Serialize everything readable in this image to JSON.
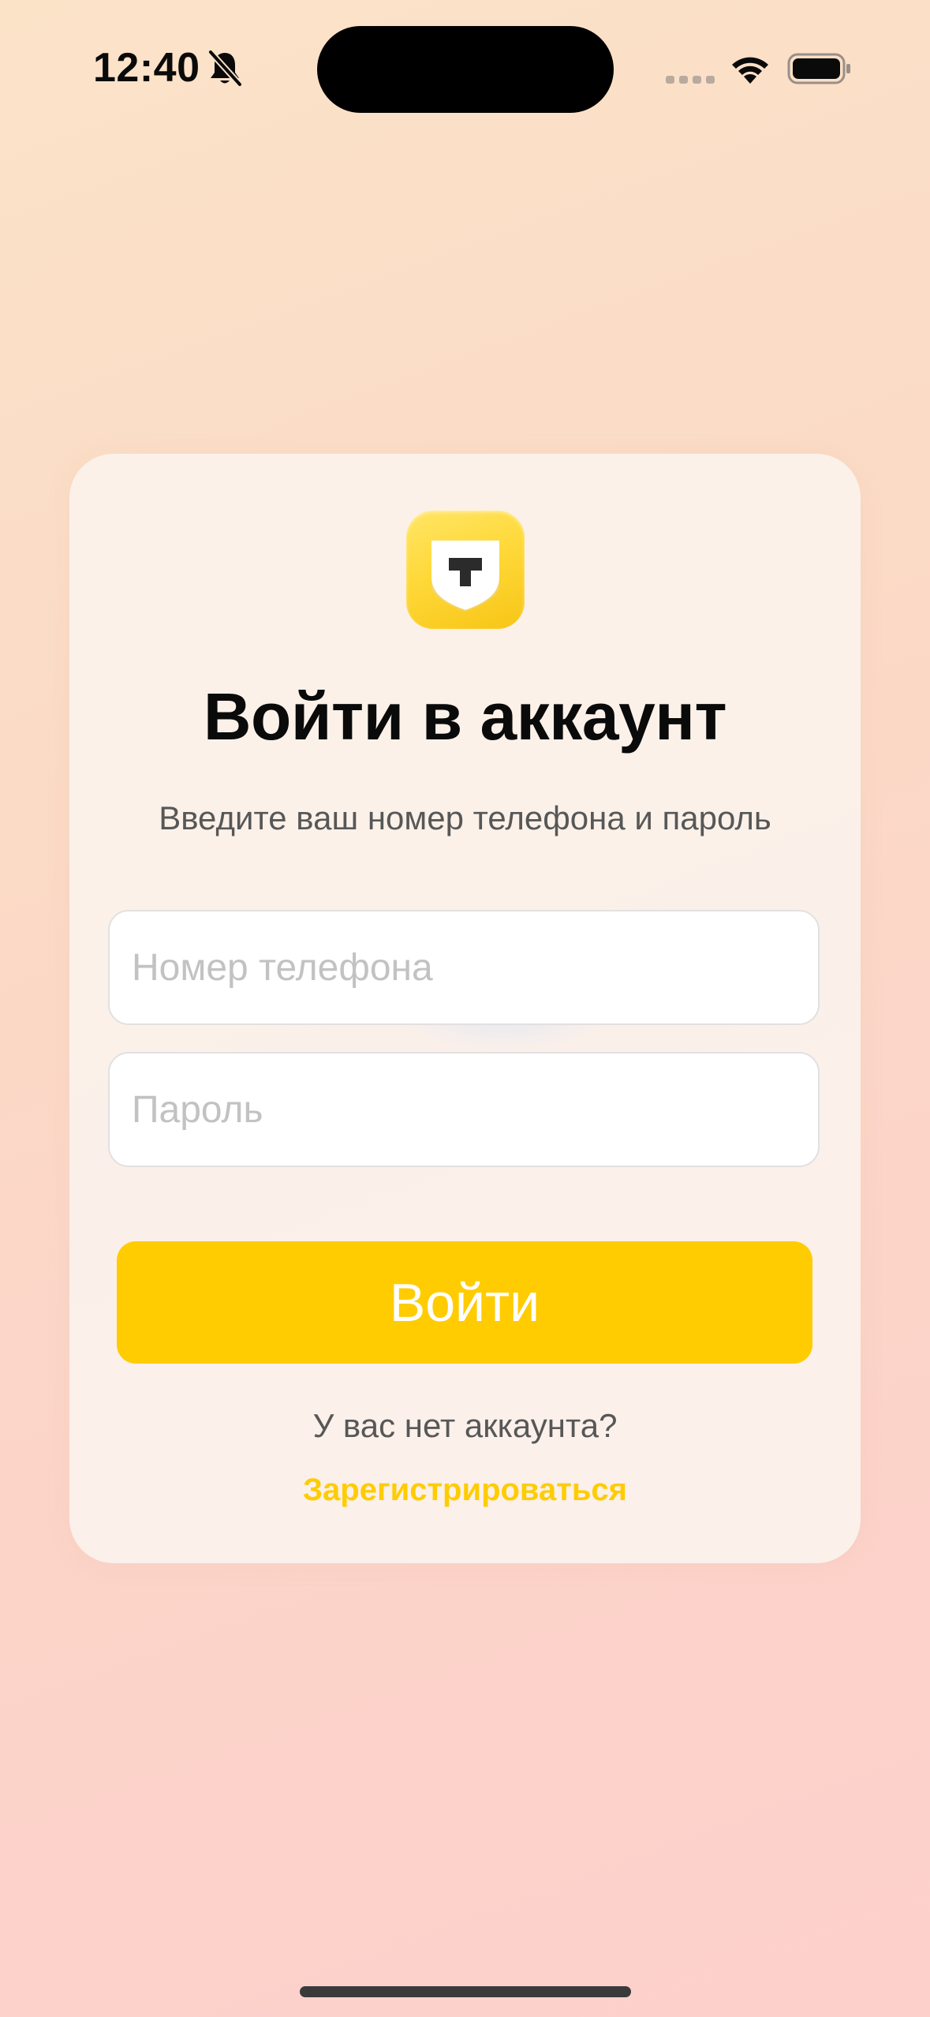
{
  "status_bar": {
    "time": "12:40",
    "icons": [
      "bell-slash-icon",
      "cellular-signal-icon",
      "wifi-icon",
      "battery-icon"
    ]
  },
  "login": {
    "logo_letter": "Т",
    "title": "Войти в аккаунт",
    "subtitle": "Введите ваш номер телефона и пароль",
    "phone_placeholder": "Номер телефона",
    "password_placeholder": "Пароль",
    "login_button_label": "Войти",
    "no_account_text": "У вас нет аккаунта?",
    "register_link": "Зарегистрироваться"
  },
  "colors": {
    "accent": "#FFCC02",
    "background_start": "#FBE3C8",
    "background_end": "#FDD0CC",
    "card": "#FBF4EE",
    "field_border": "#E2E0E0",
    "placeholder": "#C2C2C2",
    "text_secondary": "#575757"
  }
}
